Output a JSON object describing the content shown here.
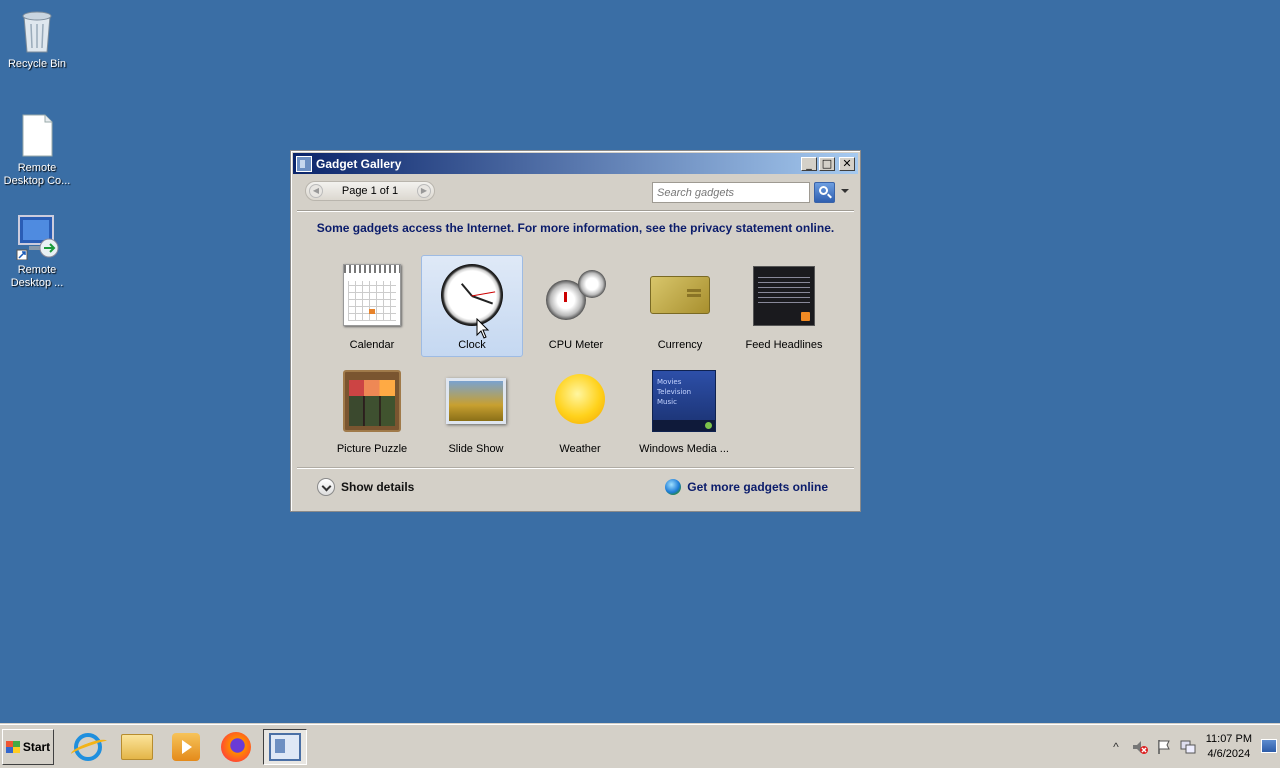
{
  "desktop": {
    "icons": [
      {
        "label": "Recycle Bin",
        "icon": "recycle-bin-icon"
      },
      {
        "label": "Remote Desktop Co...",
        "icon": "document-icon"
      },
      {
        "label": "Remote Desktop ...",
        "icon": "remote-desktop-icon"
      }
    ]
  },
  "window": {
    "title": "Gadget Gallery",
    "controls": {
      "minimize": "_",
      "maximize": "□",
      "close": "✕"
    },
    "pager": {
      "text": "Page 1 of 1",
      "prev": "◀",
      "next": "▶"
    },
    "search": {
      "placeholder": "Search gadgets"
    },
    "notice": "Some gadgets access the Internet.  For more information, see the privacy statement online.",
    "gadgets": [
      {
        "name": "Calendar"
      },
      {
        "name": "Clock",
        "selected": true
      },
      {
        "name": "CPU Meter"
      },
      {
        "name": "Currency"
      },
      {
        "name": "Feed Headlines"
      },
      {
        "name": "Picture Puzzle"
      },
      {
        "name": "Slide Show"
      },
      {
        "name": "Weather"
      },
      {
        "name": "Windows Media ..."
      }
    ],
    "media_thumb_lines": [
      "Movies",
      "Television",
      "Music"
    ],
    "footer": {
      "show_details": "Show details",
      "get_more": "Get more gadgets online"
    }
  },
  "taskbar": {
    "start_label": "Start",
    "apps": [
      {
        "icon": "internet-explorer-icon"
      },
      {
        "icon": "file-explorer-icon"
      },
      {
        "icon": "media-player-icon"
      },
      {
        "icon": "firefox-icon"
      },
      {
        "icon": "gadget-gallery-icon",
        "active": true
      }
    ],
    "tray": {
      "expand": "^"
    },
    "clock": {
      "time": "11:07 PM",
      "date": "4/6/2024"
    }
  },
  "colors": {
    "desktop_bg": "#3a6ea5",
    "window_bg": "#d4d0c8",
    "title_gradient_start": "#0a246a",
    "title_gradient_end": "#a6caf0",
    "link_text": "#0b1c6b"
  }
}
